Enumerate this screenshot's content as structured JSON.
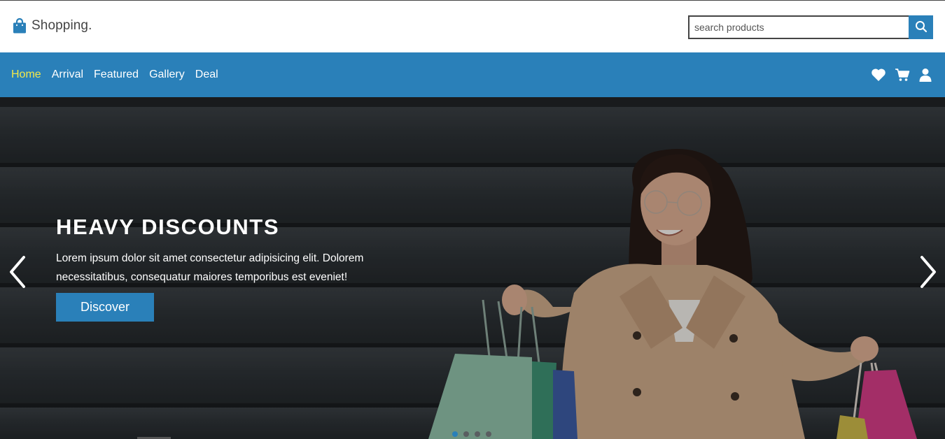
{
  "brand": {
    "name": "Shopping.",
    "icon": "shopping-bag-icon"
  },
  "search": {
    "placeholder": "search products",
    "icon": "search-icon"
  },
  "nav": {
    "links": [
      {
        "label": "Home",
        "active": true
      },
      {
        "label": "Arrival",
        "active": false
      },
      {
        "label": "Featured",
        "active": false
      },
      {
        "label": "Gallery",
        "active": false
      },
      {
        "label": "Deal",
        "active": false
      }
    ],
    "icons": [
      "heart-icon",
      "cart-icon",
      "user-icon"
    ]
  },
  "hero": {
    "title": "HEAVY DISCOUNTS",
    "text": "Lorem ipsum dolor sit amet consectetur adipisicing elit. Dolorem necessitatibus, consequatur maiores temporibus est eveniet!",
    "button": "Discover",
    "slides": 4,
    "active_slide": 1
  },
  "colors": {
    "primary": "#2a80b9",
    "active_link": "#f3e84a",
    "hero_bg": "#2a2e31"
  }
}
